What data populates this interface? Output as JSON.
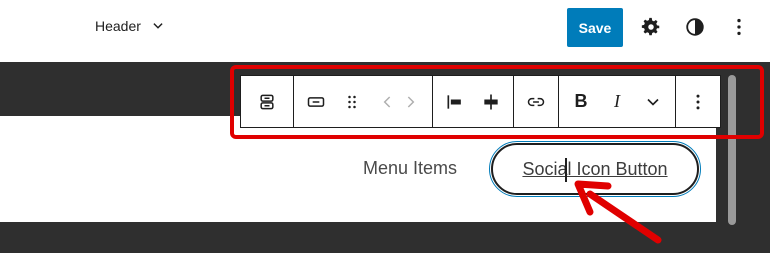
{
  "header": {
    "doc_title": "Header",
    "save_label": "Save"
  },
  "toolbar": {
    "bold_label": "B",
    "italic_label": "I"
  },
  "canvas": {
    "menu_items_label": "Menu Items",
    "social_button_label": "Social Icon Button"
  },
  "colors": {
    "accent": "#007cba",
    "highlight": "#e00000"
  }
}
